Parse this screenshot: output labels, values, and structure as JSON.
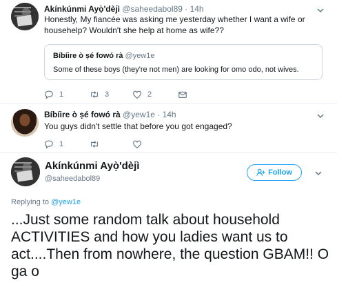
{
  "tweet1": {
    "name": "Akínkúnmi Ayọ̀'dèjì",
    "handle": "@saheedabol89 · 14h",
    "text": "Honestly, My fiancée was asking me yesterday whether I want a wife or househelp? Wouldn't she help at home as wife??",
    "quote": {
      "name": "Bíbíire ò ṣé fowó rà",
      "handle": "@yew1e",
      "text": "Some of these boys (they're not men) are looking for omo odo, not wives."
    },
    "actions": {
      "reply_count": "1",
      "retweet_count": "3",
      "like_count": "2"
    }
  },
  "tweet2": {
    "name": "Bíbíire ò ṣé fowó rà",
    "handle": "@yew1e · 14h",
    "text": "You guys didn't settle that before you got engaged?",
    "actions": {
      "reply_count": "1"
    }
  },
  "main_tweet": {
    "name": "Akínkúnmi Ayọ̀'dèjì",
    "handle": "@saheedabol89",
    "follow_label": "Follow",
    "replying_prefix": "Replying to",
    "replying_to": "@yew1e",
    "text": "...Just some random talk about household ACTIVITIES and how you ladies want us to act....Then from nowhere, the question GBAM!! O ga o"
  },
  "colors": {
    "accent": "#1da1f2",
    "muted": "#657786",
    "border": "#e6ecf0"
  },
  "icons": [
    "reply-icon",
    "retweet-icon",
    "like-icon",
    "message-icon",
    "chevron-down-icon",
    "add-user-icon"
  ]
}
